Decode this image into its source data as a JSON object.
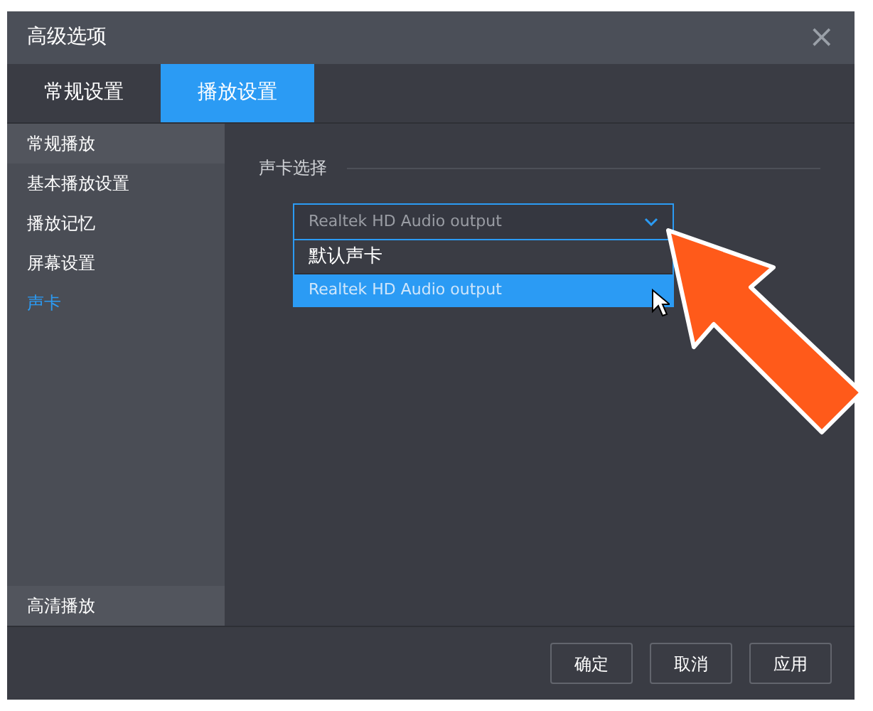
{
  "window": {
    "title": "高级选项",
    "close": "×"
  },
  "tabs": [
    {
      "label": "常规设置",
      "selected": false
    },
    {
      "label": "播放设置",
      "selected": true
    }
  ],
  "sidebar": {
    "items": [
      {
        "kind": "header",
        "label": "常规播放",
        "selected": false
      },
      {
        "kind": "item",
        "label": "基本播放设置",
        "selected": false
      },
      {
        "kind": "item",
        "label": "播放记忆",
        "selected": false
      },
      {
        "kind": "item",
        "label": "屏幕设置",
        "selected": false
      },
      {
        "kind": "item",
        "label": "声卡",
        "selected": true
      }
    ],
    "footer_item": {
      "label": "高清播放"
    }
  },
  "sound_card": {
    "legend": "声卡选择",
    "value": "Realtek HD Audio output",
    "expanded": true,
    "options": [
      {
        "label": "默认声卡",
        "selected": false
      },
      {
        "label": "Realtek HD Audio output",
        "selected": true
      }
    ]
  },
  "buttons": [
    "确定",
    "取消",
    "应用"
  ]
}
